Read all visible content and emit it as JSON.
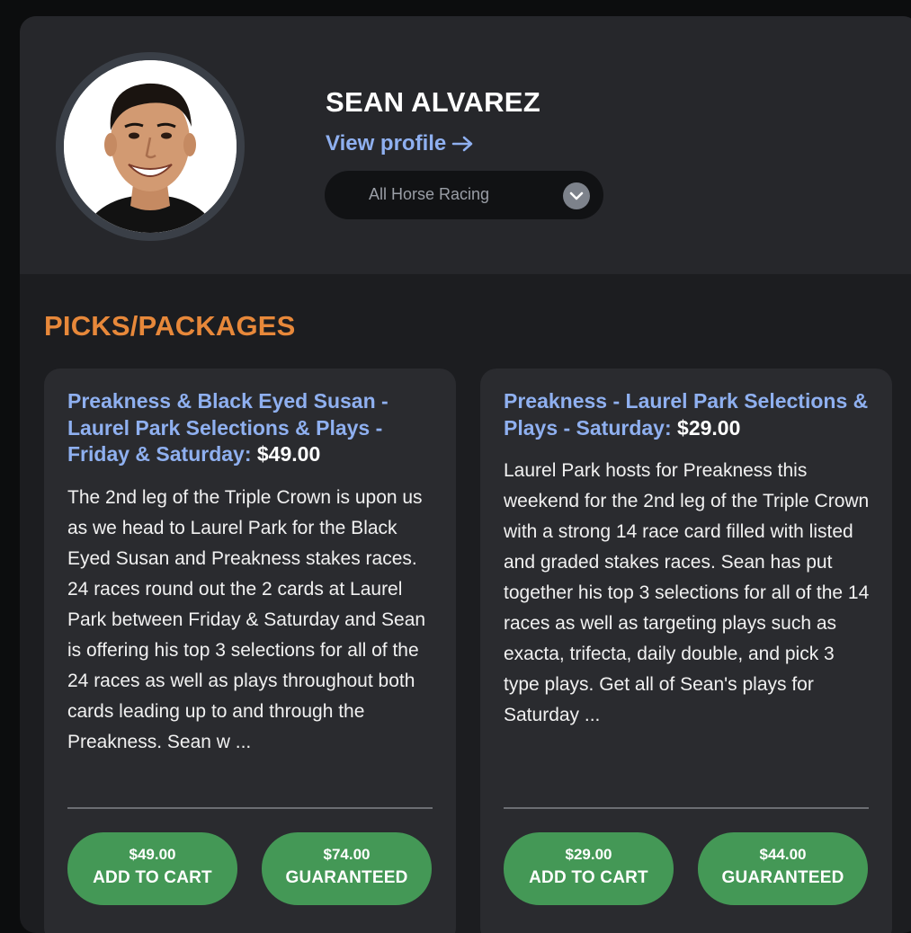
{
  "profile": {
    "name": "SEAN ALVAREZ",
    "view_profile_label": "View profile",
    "filter_selected": "All Horse Racing"
  },
  "section_title": "PICKS/PACKAGES",
  "cards": [
    {
      "title": "Preakness & Black Eyed Susan - Laurel Park Selections & Plays - Friday & Saturday:",
      "price": "$49.00",
      "description": "The 2nd leg of the Triple Crown is upon us as we head to Laurel Park for the Black Eyed Susan and Preakness stakes races. 24 races round out the 2 cards at Laurel Park between Friday & Saturday and Sean is offering his top 3 selections for all of the 24 races as well as plays throughout both cards leading up to and through the Preakness. Sean w ...",
      "buttons": [
        {
          "price": "$49.00",
          "label": "ADD TO CART"
        },
        {
          "price": "$74.00",
          "label": "GUARANTEED"
        }
      ]
    },
    {
      "title": "Preakness - Laurel Park Selections & Plays - Saturday:",
      "price": "$29.00",
      "description": "Laurel Park hosts for Preakness this weekend for the 2nd leg of the Triple Crown with a strong 14 race card filled with listed and graded stakes races. Sean has put together his top 3 selections for all of the 14 races as well as targeting plays such as exacta, trifecta, daily double, and pick 3 type plays. Get all of Sean's plays for Saturday ...",
      "buttons": [
        {
          "price": "$29.00",
          "label": "ADD TO CART"
        },
        {
          "price": "$44.00",
          "label": "GUARANTEED"
        }
      ]
    }
  ],
  "colors": {
    "accent_orange": "#e7883a",
    "link_blue": "#8fb0f0",
    "button_green": "#449856"
  }
}
